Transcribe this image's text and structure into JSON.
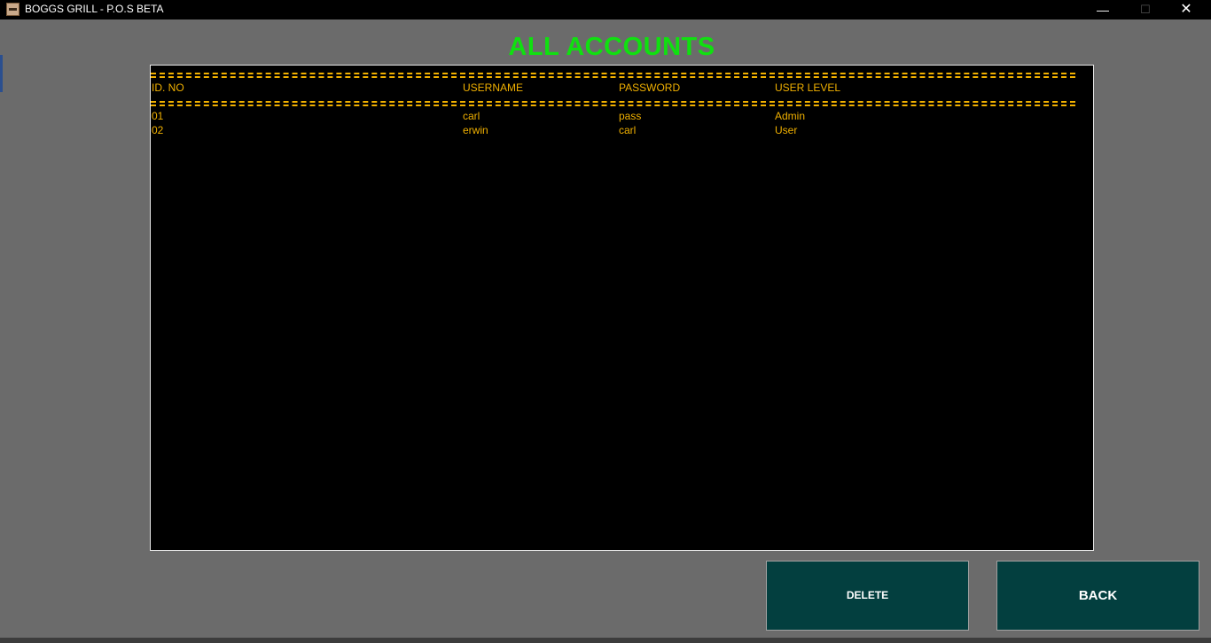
{
  "window": {
    "title": "BOGGS GRILL - P.O.S BETA",
    "icon": "app-icon",
    "controls": {
      "minimize": "—",
      "maximize": "☐",
      "close": "✕"
    }
  },
  "page": {
    "heading": "ALL ACCOUNTS",
    "heading_color": "#10e010"
  },
  "accounts": {
    "text_color": "#f0b000",
    "columns": [
      "ID. NO",
      "USERNAME",
      "PASSWORD",
      "USER LEVEL"
    ],
    "rows": [
      [
        "01",
        "carl",
        "pass",
        "Admin"
      ],
      [
        "02",
        "erwin",
        "carl",
        "User"
      ]
    ]
  },
  "actions": {
    "delete_label": "DELETE",
    "back_label": "BACK",
    "button_color": "#033f3f"
  }
}
